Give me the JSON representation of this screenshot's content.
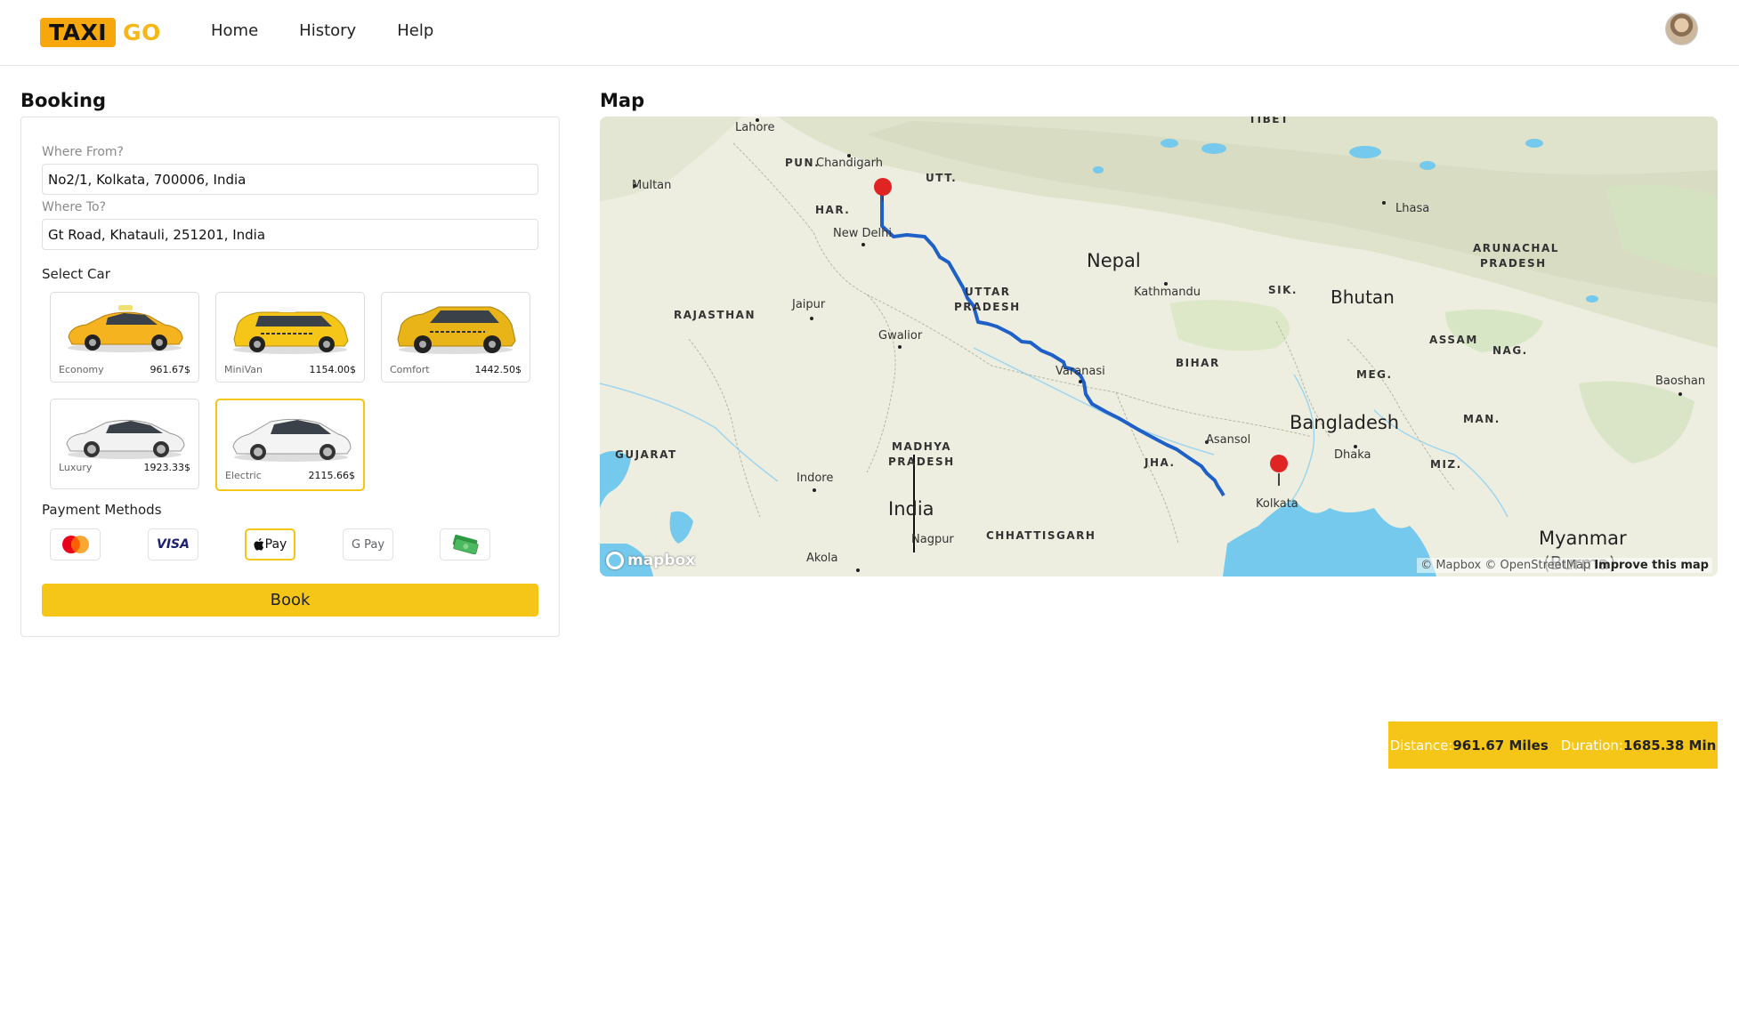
{
  "brand": {
    "part1": "TAXI",
    "part2": "GO"
  },
  "nav": {
    "items": [
      "Home",
      "History",
      "Help"
    ]
  },
  "booking": {
    "title": "Booking",
    "from_label": "Where From?",
    "from_value": "No2/1, Kolkata, 700006, India",
    "to_label": "Where To?",
    "to_value": "Gt Road, Khatauli, 251201, India",
    "select_car_label": "Select Car",
    "cars": [
      {
        "name": "Economy",
        "price": "961.67$",
        "color": "#f5b320"
      },
      {
        "name": "MiniVan",
        "price": "1154.00$",
        "color": "#f5c518"
      },
      {
        "name": "Comfort",
        "price": "1442.50$",
        "color": "#e8b417"
      },
      {
        "name": "Luxury",
        "price": "1923.33$",
        "color": "#eeeeee"
      },
      {
        "name": "Electric",
        "price": "2115.66$",
        "color": "#eeeeee",
        "selected": true
      }
    ],
    "payment_label": "Payment Methods",
    "payment_methods": [
      {
        "icon": "mastercard-icon",
        "label": ""
      },
      {
        "icon": "visa-icon",
        "label": "VISA"
      },
      {
        "icon": "apple-pay-icon",
        "label": "Pay",
        "selected": true
      },
      {
        "icon": "google-pay-icon",
        "label": "G Pay"
      },
      {
        "icon": "cash-icon",
        "label": ""
      }
    ],
    "book_label": "Book"
  },
  "map": {
    "title": "Map",
    "labels": {
      "tibet": "TIBET",
      "lahore": "Lahore",
      "pun": "PUN.",
      "chandigarh": "Chandigarh",
      "utt": "UTT.",
      "multan": "Multan",
      "har": "HAR.",
      "lhasa": "Lhasa",
      "new_delhi": "New Delhi",
      "arunachal": "ARUNACHAL",
      "pradesh_a": "PRADESH",
      "nepal": "Nepal",
      "uttar": "UTTAR",
      "pradesh_u": "PRADESH",
      "kathmandu": "Kathmandu",
      "sik": "SIK.",
      "bhutan": "Bhutan",
      "rajasthan": "RAJASTHAN",
      "jaipur": "Jaipur",
      "gwalior": "Gwalior",
      "assam": "ASSAM",
      "nag": "NAG.",
      "bihar": "BIHAR",
      "meg": "MEG.",
      "varanasi": "Varanasi",
      "baoshan": "Baoshan",
      "man": "MAN.",
      "bangladesh": "Bangladesh",
      "asansol": "Asansol",
      "madhya": "MADHYA",
      "pradesh_m": "PRADESH",
      "gujarat": "GUJARAT",
      "dhaka": "Dhaka",
      "jha": "JHA.",
      "miz": "MIZ.",
      "indore": "Indore",
      "india": "India",
      "kolkata": "Kolkata",
      "chhattisgarh": "CHHATTISGARH",
      "nagpur": "Nagpur",
      "myanmar": "Myanmar",
      "burma": "(Burma)",
      "akola": "Akola"
    },
    "mapbox_logo": "mapbox",
    "attribution": "© Mapbox © OpenStreetMap",
    "improve": "Improve this map",
    "colors": {
      "water": "#74c9ec",
      "route": "#1f5fc8",
      "marker": "#e02424",
      "land": "#eceede",
      "hills": "#d7dcc7"
    }
  },
  "trip": {
    "distance_label": "Distance:",
    "distance_value": "961.67 Miles",
    "duration_label": "Duration:",
    "duration_value": "1685.38 Min"
  },
  "accent": "#f5c518"
}
